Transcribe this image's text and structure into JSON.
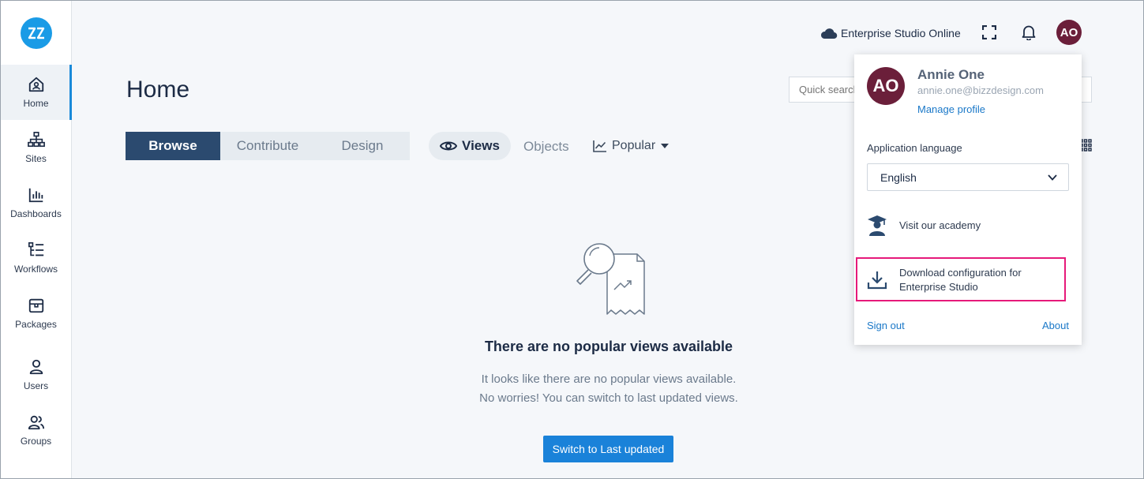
{
  "sidebar": {
    "items": [
      {
        "label": "Home",
        "icon": "home-icon",
        "active": true
      },
      {
        "label": "Sites",
        "icon": "sitemap-icon"
      },
      {
        "label": "Dashboards",
        "icon": "bar-chart-icon"
      },
      {
        "label": "Workflows",
        "icon": "workflow-icon"
      },
      {
        "label": "Packages",
        "icon": "package-icon"
      },
      {
        "label": "Users",
        "icon": "user-icon"
      },
      {
        "label": "Groups",
        "icon": "users-icon"
      }
    ]
  },
  "topbar": {
    "environment": "Enterprise Studio Online",
    "avatar_initials": "AO"
  },
  "main": {
    "title": "Home",
    "segments": [
      "Browse",
      "Contribute",
      "Design"
    ],
    "views_label": "Views",
    "objects_label": "Objects",
    "popular_label": "Popular",
    "search_placeholder": "Quick search",
    "empty": {
      "title": "There are no popular views available",
      "line1": "It looks like there are no popular views available.",
      "line2": "No worries! You can switch to last updated views.",
      "button": "Switch to Last updated"
    }
  },
  "profile_menu": {
    "initials": "AO",
    "name": "Annie One",
    "email": "annie.one@bizzdesign.com",
    "manage_profile": "Manage profile",
    "language_label": "Application language",
    "language_value": "English",
    "academy": "Visit our academy",
    "download_line1": "Download configuration for",
    "download_line2": "Enterprise Studio",
    "sign_out": "Sign out",
    "about": "About"
  },
  "colors": {
    "brand": "#1a9be6",
    "primary_button": "#1a82d9",
    "segment_active": "#2b4a6f",
    "avatar": "#6b1f3a",
    "highlight": "#e6197a",
    "link": "#1a78c8"
  }
}
